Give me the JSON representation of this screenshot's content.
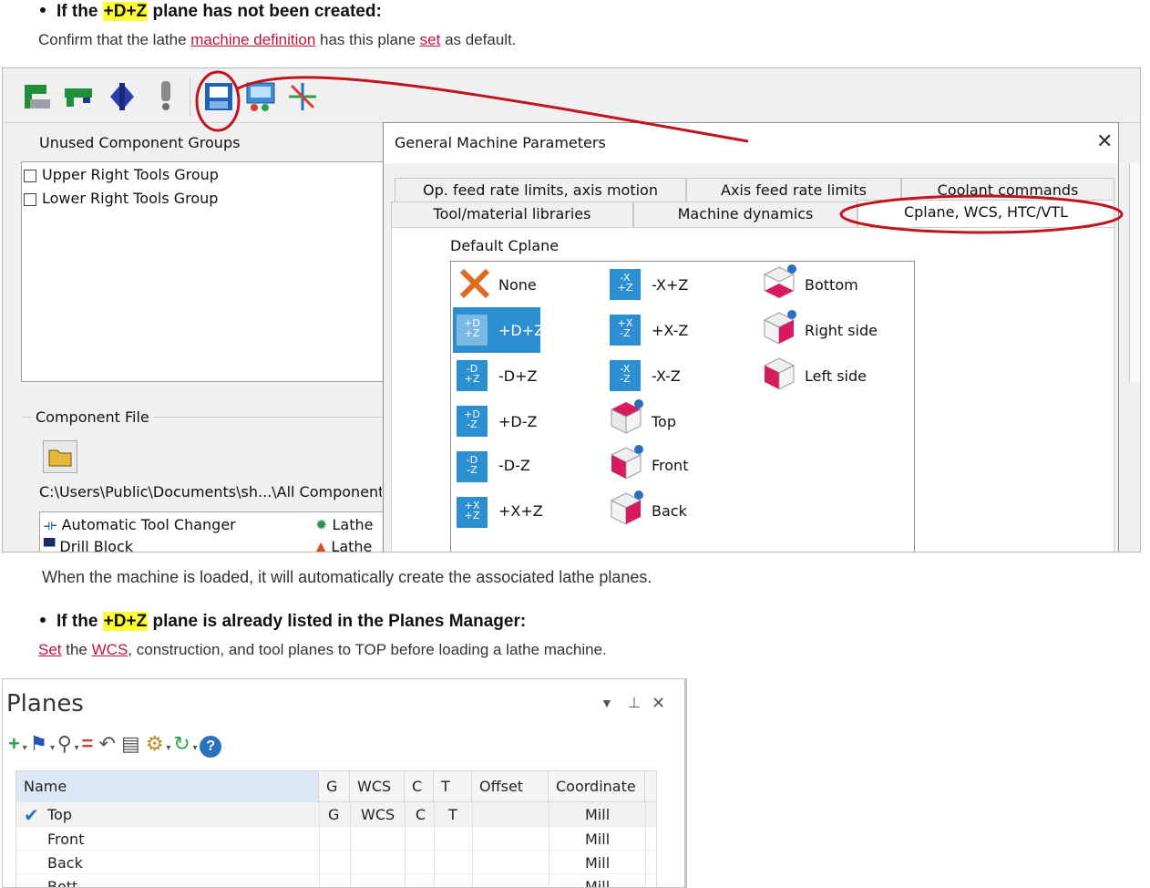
{
  "section1": {
    "bullet_prefix": "If the ",
    "bullet_highlight": "+D+Z",
    "bullet_suffix": " plane has not been created:",
    "para_a": "Confirm that the lathe ",
    "para_link1": "machine definition",
    "para_b": " has this plane ",
    "para_link2": "set",
    "para_c": " as default."
  },
  "screenshot1": {
    "toolbar_icons": [
      "component-icon",
      "slide-icon",
      "spindle-icon",
      "warning-icon",
      "general-machine-parameters-icon",
      "control-definition-icon",
      "axis-icon"
    ],
    "unused_groups_label": "Unused Component Groups",
    "groups": [
      "Upper Right Tools Group",
      "Lower Right Tools Group"
    ],
    "component_file_label": "Component File",
    "component_path": "C:\\Users\\Public\\Documents\\sh...\\All Components.m",
    "components_left": [
      "Automatic Tool Changer",
      "Drill Block"
    ],
    "components_right": [
      "Lathe",
      "Lathe"
    ],
    "dialog": {
      "title": "General Machine Parameters",
      "tabs_row1": [
        "Op. feed rate limits, axis motion",
        "Axis feed rate limits",
        "Coolant commands"
      ],
      "tabs_row2": [
        "Tool/material libraries",
        "Machine dynamics",
        "Cplane, WCS, HTC/VTL"
      ],
      "default_cplane_label": "Default Cplane",
      "col1": [
        {
          "label": "None",
          "icon": "x-icon"
        },
        {
          "label": "+D+Z",
          "icon": "+D/+Z",
          "selected": true
        },
        {
          "label": "-D+Z",
          "icon": "-D/+Z"
        },
        {
          "label": "+D-Z",
          "icon": "+D/-Z"
        },
        {
          "label": "-D-Z",
          "icon": "-D/-Z"
        },
        {
          "label": "+X+Z",
          "icon": "+X/+Z"
        }
      ],
      "col2": [
        {
          "label": "-X+Z",
          "icon": "-X/+Z"
        },
        {
          "label": "+X-Z",
          "icon": "+X/-Z"
        },
        {
          "label": "-X-Z",
          "icon": "-X/-Z"
        },
        {
          "label": "Top",
          "icon": "cube-top-icon"
        },
        {
          "label": "Front",
          "icon": "cube-front-icon"
        },
        {
          "label": "Back",
          "icon": "cube-back-icon"
        }
      ],
      "col3": [
        {
          "label": "Bottom",
          "icon": "cube-bottom-icon"
        },
        {
          "label": "Right side",
          "icon": "cube-right-icon"
        },
        {
          "label": "Left side",
          "icon": "cube-left-icon"
        }
      ]
    },
    "annotation_color": "#c0141e",
    "selection_color": "#2b8fd1"
  },
  "section2": {
    "para": "When the machine is loaded, it will automatically create the associated lathe planes.",
    "bullet_prefix": "If the ",
    "bullet_highlight": "+D+Z",
    "bullet_suffix": " plane is already listed in the Planes Manager:",
    "para2_link1": "Set",
    "para2_a": " the ",
    "para2_link2": "WCS",
    "para2_b": ", construction, and tool planes to TOP before loading a lathe machine."
  },
  "planes": {
    "title": "Planes",
    "window_icons": [
      "dropdown-icon",
      "pin-icon",
      "close-icon"
    ],
    "toolbar_icons": [
      "add-icon",
      "flag-icon",
      "search-icon",
      "equals-icon",
      "undo-icon",
      "document-icon",
      "gear-icon",
      "refresh-icon",
      "help-icon"
    ],
    "columns": [
      "Name",
      "G",
      "WCS",
      "C",
      "T",
      "Offset",
      "Coordinate"
    ],
    "rows": [
      {
        "name": "Top",
        "g": "G",
        "wcs": "WCS",
        "c": "C",
        "t": "T",
        "offset": "",
        "coord": "Mill",
        "checked": true
      },
      {
        "name": "Front",
        "g": "",
        "wcs": "",
        "c": "",
        "t": "",
        "offset": "",
        "coord": "Mill"
      },
      {
        "name": "Back",
        "g": "",
        "wcs": "",
        "c": "",
        "t": "",
        "offset": "",
        "coord": "Mill"
      },
      {
        "name": "Bott",
        "g": "",
        "wcs": "",
        "c": "",
        "t": "",
        "offset": "",
        "coord": "Mill"
      }
    ]
  }
}
